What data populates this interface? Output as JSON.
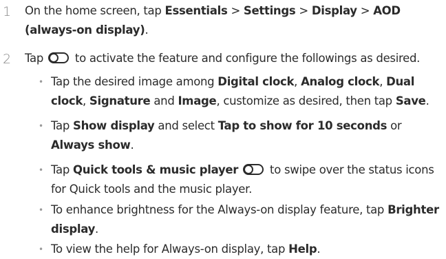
{
  "step1": {
    "number": "1",
    "t0": "On the home screen, tap ",
    "b0": "Essentials",
    "t1": " > ",
    "b1": "Settings",
    "t2": " > ",
    "b2": "Display",
    "t3": " > ",
    "b3": "AOD (always-on display)",
    "t4": "."
  },
  "step2": {
    "number": "2",
    "t0": "Tap ",
    "t1": " to activate the feature and configure the followings as desired.",
    "toggle_icon": "toggle-switch-icon"
  },
  "bullets": {
    "marker": "•",
    "b1": {
      "t0": "Tap the desired image among ",
      "b0": "Digital clock",
      "t1": ", ",
      "b1": "Analog clock",
      "t2": ", ",
      "b2": "Dual clock",
      "t3": ", ",
      "b3": "Signature",
      "t4": " and ",
      "b4": "Image",
      "t5": ", customize as desired, then tap ",
      "b5": "Save",
      "t6": "."
    },
    "b2": {
      "t0": "Tap ",
      "b0": "Show display",
      "t1": " and select ",
      "b1": "Tap to show for 10 seconds",
      "t2": " or ",
      "b2": "Always show",
      "t3": "."
    },
    "b3": {
      "t0": "Tap ",
      "b0": "Quick tools & music player",
      "t1": " to swipe over the status icons for Quick tools and the music player."
    },
    "b4": {
      "t0": "To enhance brightness for the Always-on display feature, tap ",
      "b0": "Brighter display",
      "t1": "."
    },
    "b5": {
      "t0": "To view the help for Always-on display, tap ",
      "b0": "Help",
      "t1": "."
    }
  }
}
